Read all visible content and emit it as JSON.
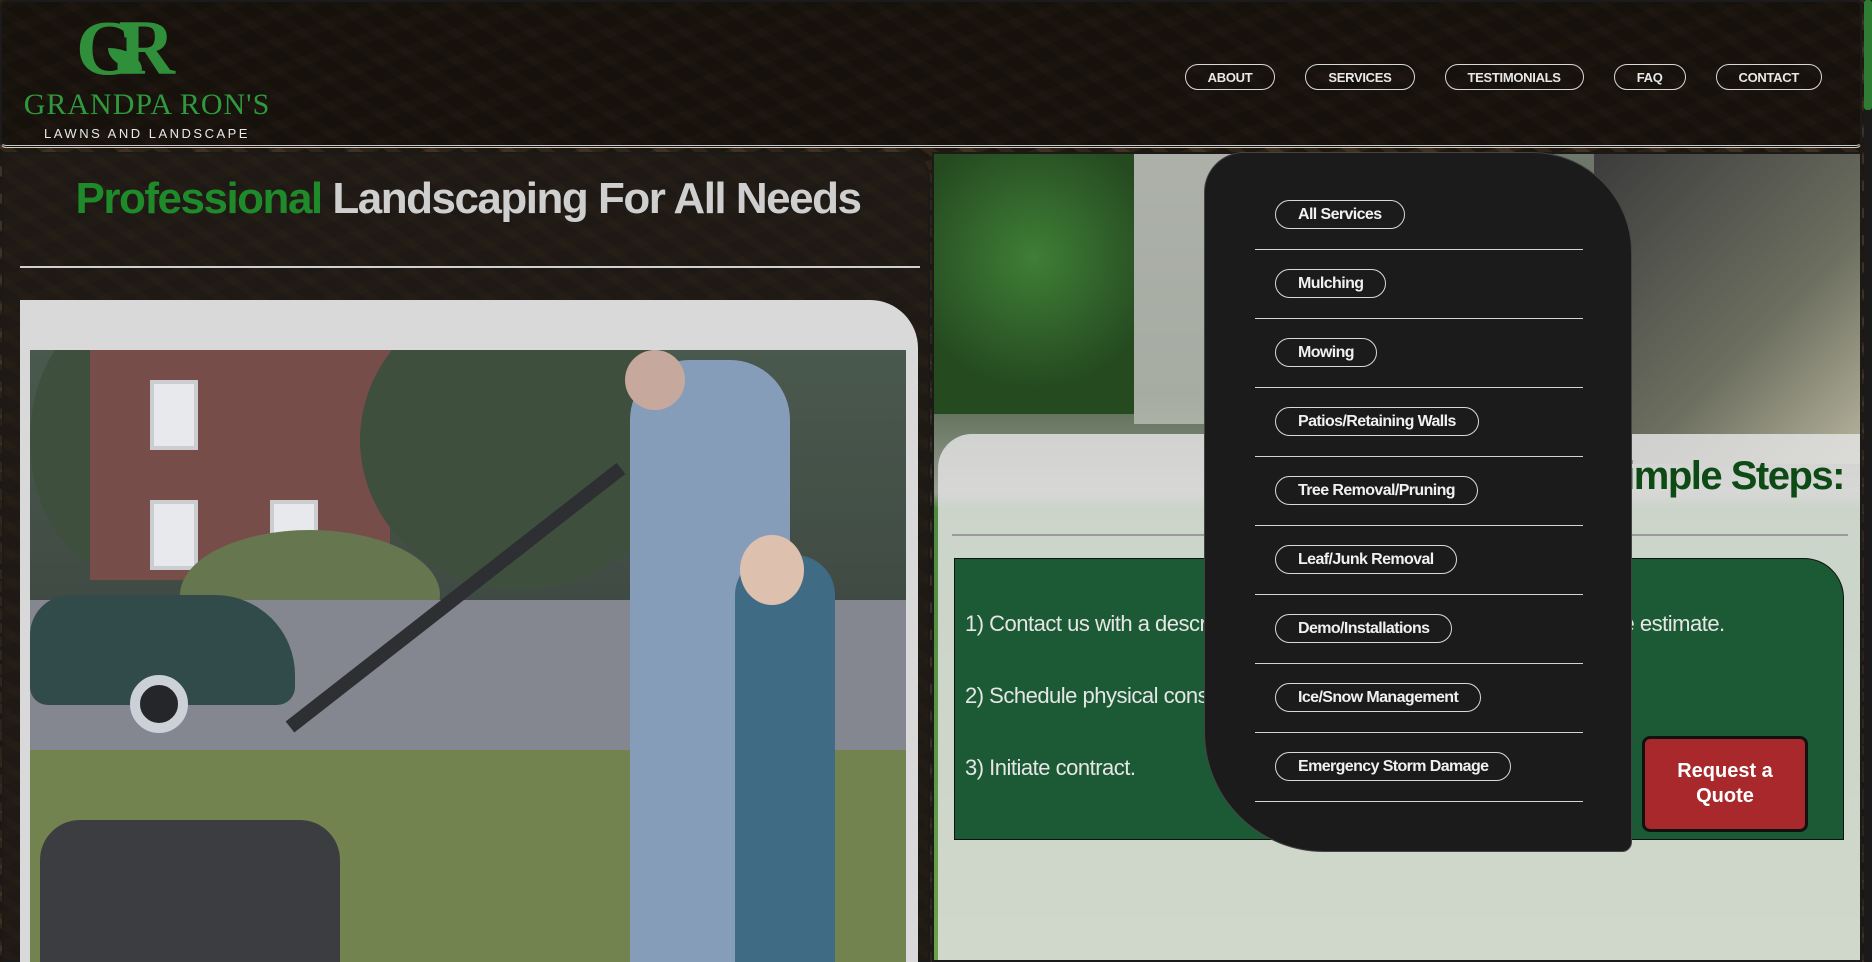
{
  "brand": {
    "monogram": "GR",
    "name": "GRANDPA RON'S",
    "tagline": "LAWNS AND LANDSCAPE",
    "color": "#2f8f3a"
  },
  "nav": {
    "items": [
      {
        "label": "ABOUT"
      },
      {
        "label": "SERVICES"
      },
      {
        "label": "TESTIMONIALS"
      },
      {
        "label": "FAQ"
      },
      {
        "label": "CONTACT"
      }
    ]
  },
  "hero": {
    "headline_accent": "Professional",
    "headline_rest": " Landscaping For All Needs",
    "accent_color": "#1f8a2a"
  },
  "services_menu": {
    "items": [
      {
        "label": "All Services"
      },
      {
        "label": "Mulching"
      },
      {
        "label": "Mowing"
      },
      {
        "label": "Patios/Retaining Walls"
      },
      {
        "label": "Tree Removal/Pruning"
      },
      {
        "label": "Leaf/Junk Removal"
      },
      {
        "label": "Demo/Installations"
      },
      {
        "label": "Ice/Snow Management"
      },
      {
        "label": "Emergency Storm Damage"
      }
    ]
  },
  "steps": {
    "title": "Three Simple Steps:",
    "items": [
      {
        "text": "1) Contact us with a description of your project and we will provide a free estimate."
      },
      {
        "text": "2) Schedule physical consultation."
      },
      {
        "text": "3) Initiate contract."
      }
    ],
    "box_color": "#1c5a36"
  },
  "cta": {
    "label": "Request a Quote",
    "color": "#a8282b"
  }
}
